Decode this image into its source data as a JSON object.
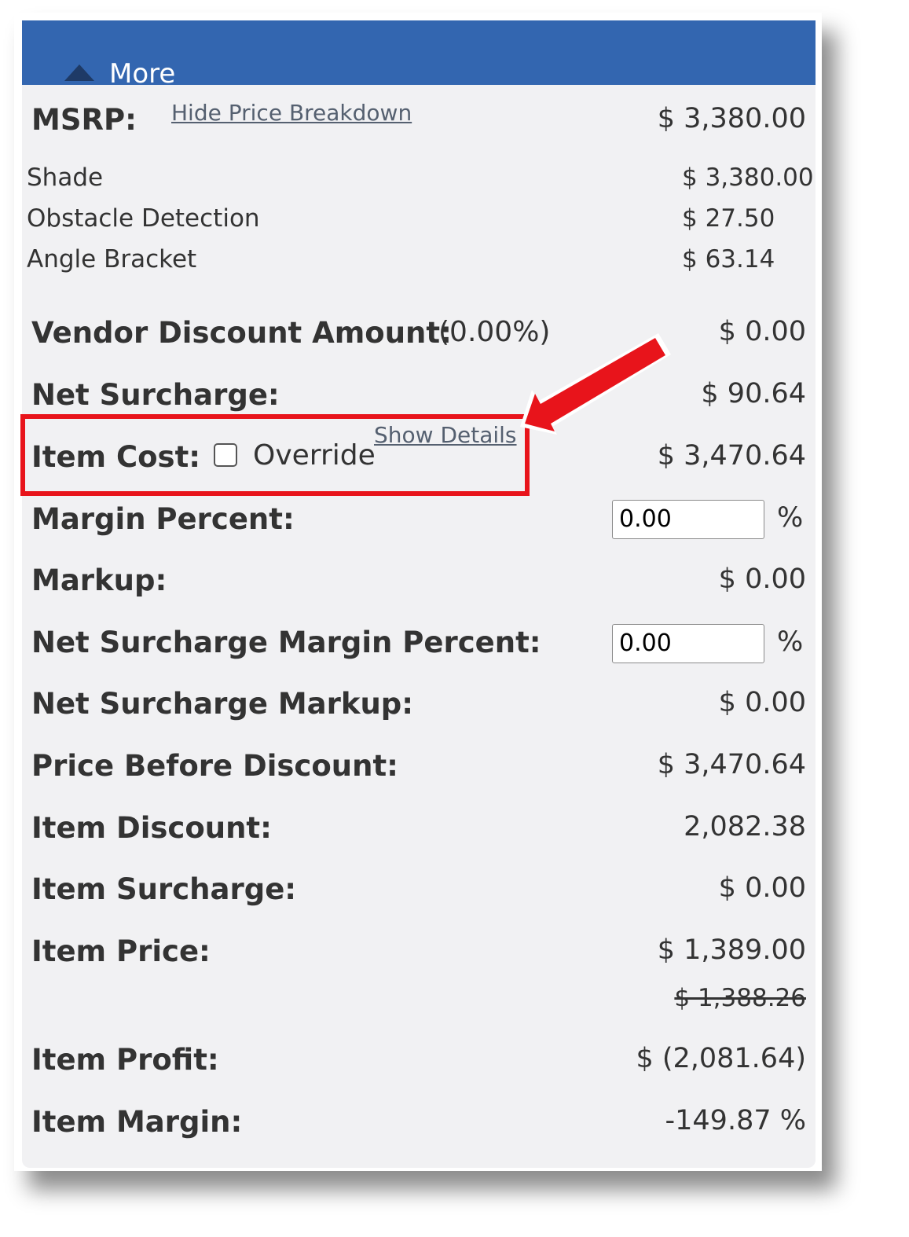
{
  "header": {
    "label": "More",
    "icon": "triangle-up-icon"
  },
  "msrp": {
    "label": "MSRP:",
    "link": "Hide Price Breakdown",
    "value": "$ 3,380.00"
  },
  "breakdown": [
    {
      "label": "Shade",
      "value": "$ 3,380.00"
    },
    {
      "label": "Obstacle Detection",
      "value": "$ 27.50"
    },
    {
      "label": "Angle Bracket",
      "value": "$ 63.14"
    }
  ],
  "vendor_discount": {
    "label": "Vendor Discount Amount:",
    "pct": "(0.00%)",
    "value": "$ 0.00"
  },
  "net_surcharge": {
    "label": "Net Surcharge:",
    "value": "$ 90.64"
  },
  "item_cost": {
    "label": "Item Cost:",
    "override_label": "Override",
    "override_checked": false,
    "link": "Show Details",
    "value": "$ 3,470.64"
  },
  "margin_percent": {
    "label": "Margin Percent:",
    "input_value": "0.00",
    "unit": "%"
  },
  "markup": {
    "label": "Markup:",
    "value": "$ 0.00"
  },
  "net_surcharge_margin_percent": {
    "label": "Net Surcharge Margin Percent:",
    "input_value": "0.00",
    "unit": "%"
  },
  "net_surcharge_markup": {
    "label": "Net Surcharge Markup:",
    "value": "$ 0.00"
  },
  "price_before_discount": {
    "label": "Price Before Discount:",
    "value": "$ 3,470.64"
  },
  "item_discount": {
    "label": "Item Discount:",
    "value": "2,082.38"
  },
  "item_surcharge": {
    "label": "Item Surcharge:",
    "value": "$ 0.00"
  },
  "item_price": {
    "label": "Item Price:",
    "value": "$ 1,389.00",
    "original_value": "$ 1,388.26"
  },
  "item_profit": {
    "label": "Item Profit:",
    "value": "$ (2,081.64)"
  },
  "item_margin": {
    "label": "Item Margin:",
    "value": "-149.87 %"
  },
  "colors": {
    "header": "#3366b0",
    "panel": "#f1f1f3",
    "highlight": "#e8141b"
  }
}
